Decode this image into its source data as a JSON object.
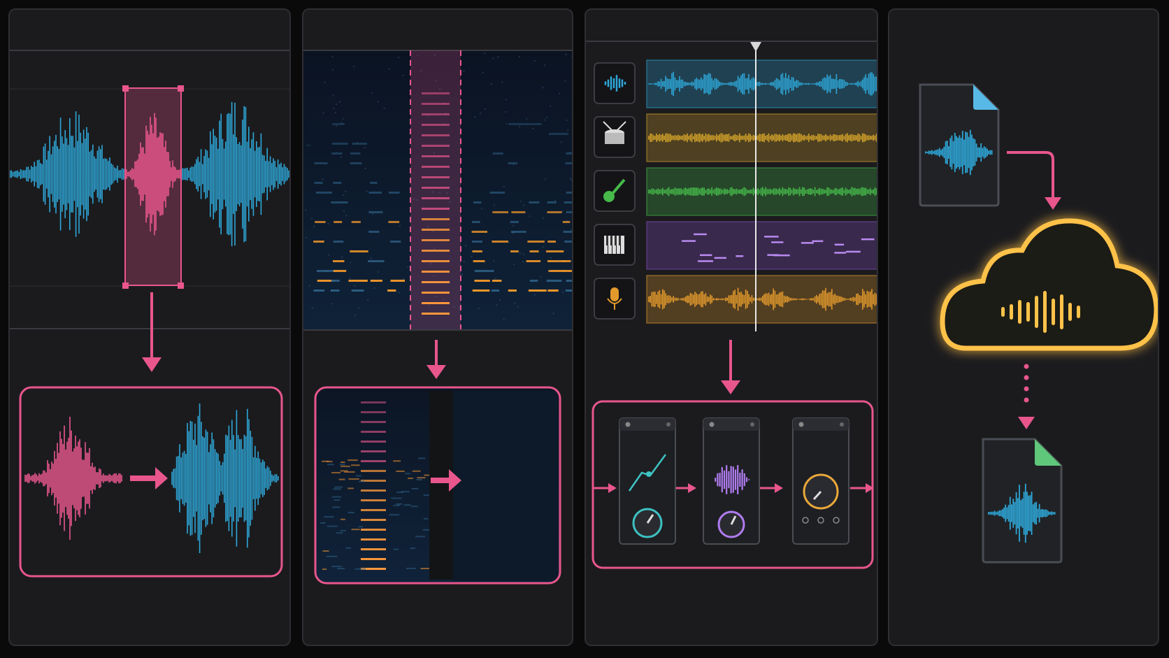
{
  "colors": {
    "background": "#0a0a0b",
    "panel": "#1b1b1e",
    "accent_pink": "#e8568c",
    "wave_blue": "#2ea7d8",
    "track_yellow": "#d4a32a",
    "track_green": "#46b94a",
    "track_purple": "#8a4fc4",
    "track_orange": "#e39a2c",
    "cloud_glow": "#ffc24a",
    "file_tab_blue": "#58b9e6",
    "file_tab_green": "#5fc77a"
  },
  "panels": [
    {
      "id": "waveform-selection-replace",
      "steps": [
        "select-region",
        "replace-region"
      ]
    },
    {
      "id": "spectrogram-remove-band",
      "steps": [
        "select-band",
        "remove-band"
      ]
    },
    {
      "id": "multitrack-effects-chain",
      "tracks": [
        {
          "icon": "waveform-icon",
          "color": "#2ea7d8"
        },
        {
          "icon": "drum-icon",
          "color": "#d4a32a"
        },
        {
          "icon": "guitar-icon",
          "color": "#46b94a"
        },
        {
          "icon": "piano-icon",
          "color": "#8a4fc4"
        },
        {
          "icon": "microphone-icon",
          "color": "#e39a2c"
        }
      ],
      "effects": [
        "eq-curve-module",
        "waveform-module",
        "knob-module"
      ]
    },
    {
      "id": "cloud-processing",
      "nodes": [
        "input-audio-file-icon",
        "cloud-audio-icon",
        "output-audio-file-icon"
      ]
    }
  ]
}
